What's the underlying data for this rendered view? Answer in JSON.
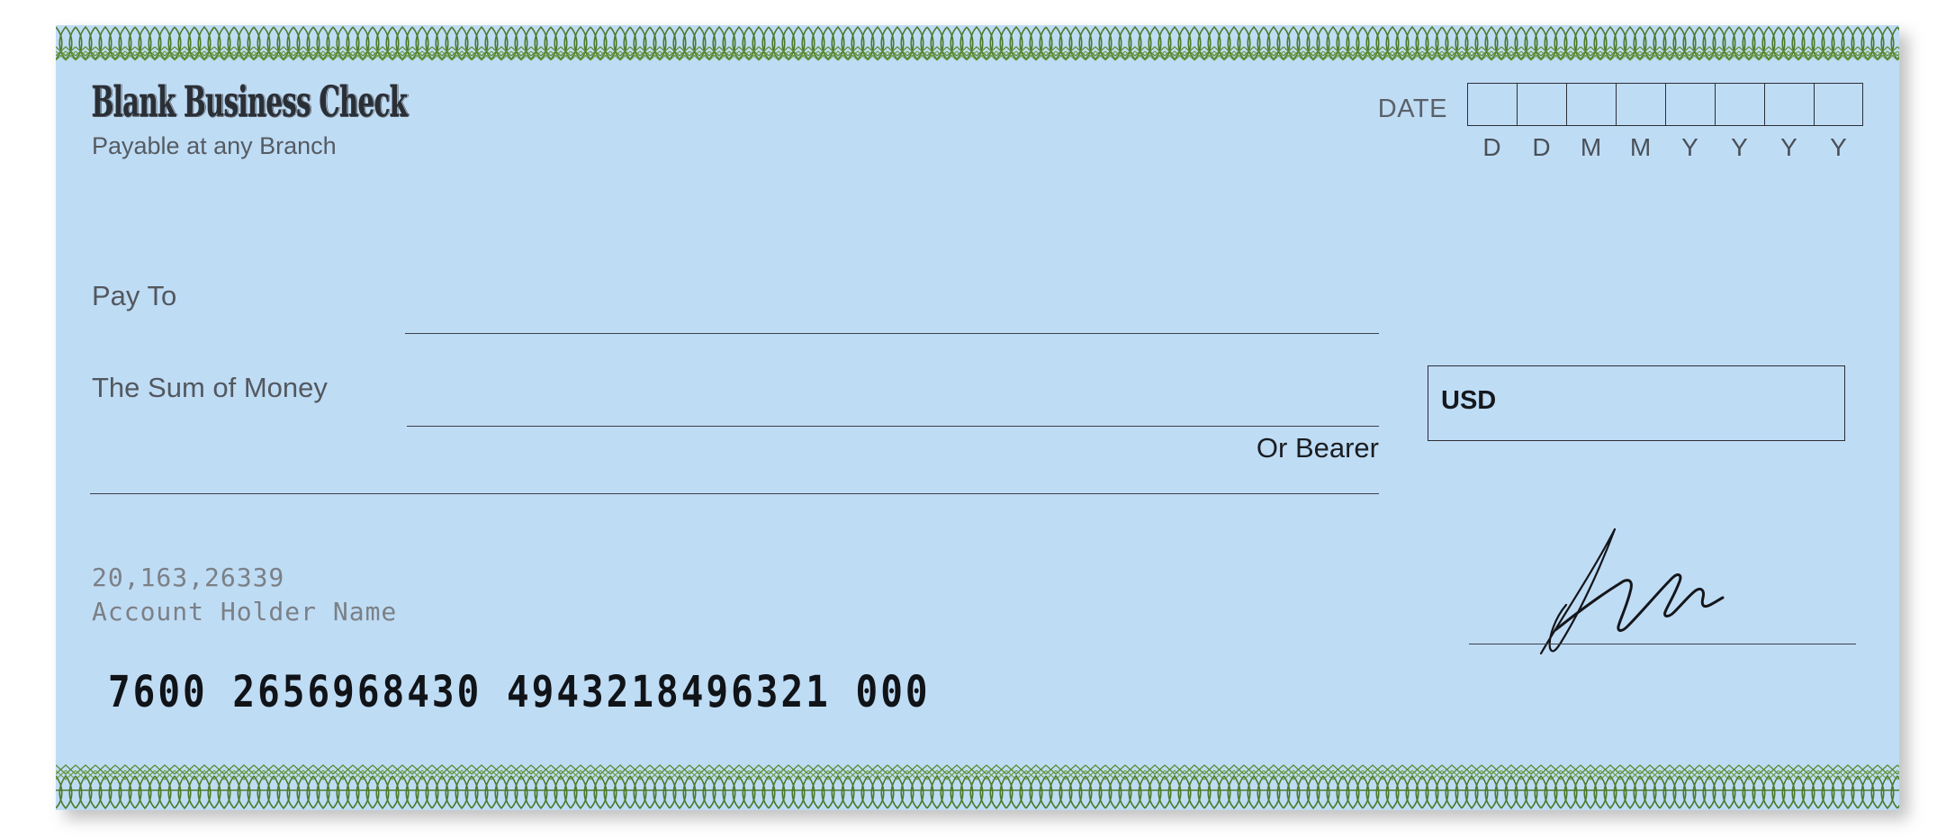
{
  "check": {
    "background_color": "#bfdcf5",
    "border_pattern_color": "#4e7a2a",
    "title": "Blank Business Check",
    "tagline": "Payable at any Branch"
  },
  "date": {
    "label": "DATE",
    "box_count": 8,
    "legend": [
      "D",
      "D",
      "M",
      "M",
      "Y",
      "Y",
      "Y",
      "Y"
    ]
  },
  "fields": {
    "pay_to_label": "Pay To",
    "sum_of_money_label": "The Sum of Money",
    "or_bearer_label": "Or Bearer"
  },
  "amount": {
    "currency": "USD",
    "value": ""
  },
  "account": {
    "number": "20,163,26339",
    "holder_name": "Account Holder Name"
  },
  "micr": {
    "line": "7600 2656968430 4943218496321 000"
  },
  "signature": {
    "label": ""
  }
}
